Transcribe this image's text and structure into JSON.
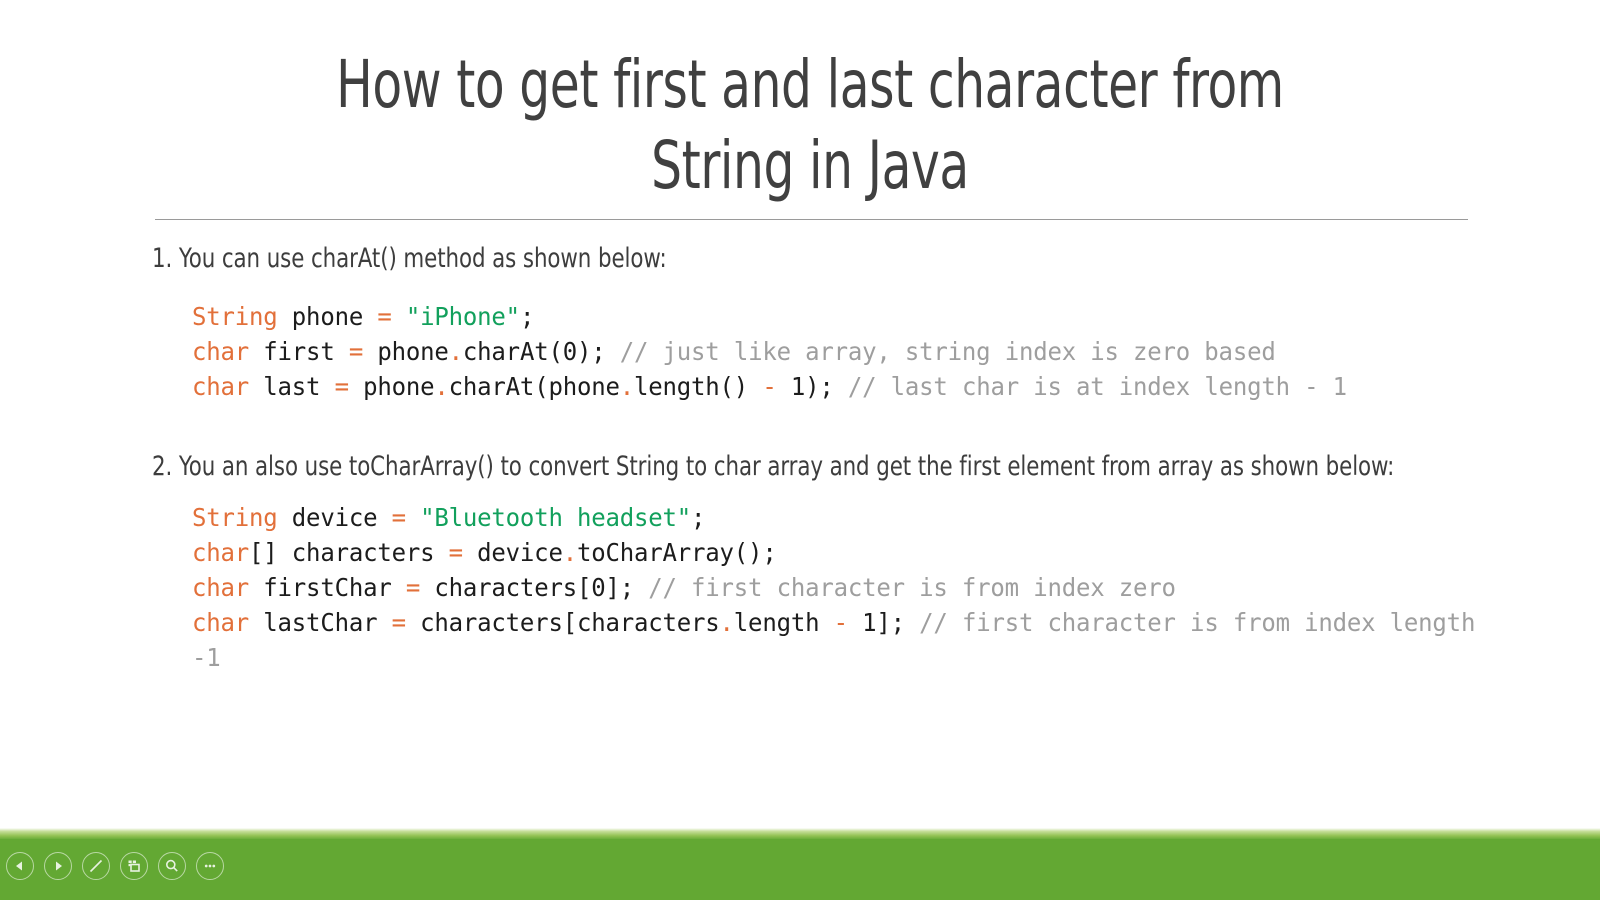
{
  "slide": {
    "title": "How to get first and last character from String in Java",
    "sections": [
      {
        "paragraph": "1. You can use charAt() method as shown below:",
        "code_lines": [
          [
            {
              "t": "String",
              "c": "kw"
            },
            {
              "t": " phone ",
              "c": "plain"
            },
            {
              "t": "=",
              "c": "op"
            },
            {
              "t": " ",
              "c": "plain"
            },
            {
              "t": "\"iPhone\"",
              "c": "str"
            },
            {
              "t": ";",
              "c": "plain"
            }
          ],
          [
            {
              "t": "char",
              "c": "kw"
            },
            {
              "t": " first ",
              "c": "plain"
            },
            {
              "t": "=",
              "c": "op"
            },
            {
              "t": " phone",
              "c": "plain"
            },
            {
              "t": ".",
              "c": "dot"
            },
            {
              "t": "charAt(0); ",
              "c": "plain"
            },
            {
              "t": "// just like array, string index is zero based",
              "c": "cmt"
            }
          ],
          [
            {
              "t": "char",
              "c": "kw"
            },
            {
              "t": " last ",
              "c": "plain"
            },
            {
              "t": "=",
              "c": "op"
            },
            {
              "t": " phone",
              "c": "plain"
            },
            {
              "t": ".",
              "c": "dot"
            },
            {
              "t": "charAt(phone",
              "c": "plain"
            },
            {
              "t": ".",
              "c": "dot"
            },
            {
              "t": "length() ",
              "c": "plain"
            },
            {
              "t": "-",
              "c": "op"
            },
            {
              "t": " 1); ",
              "c": "plain"
            },
            {
              "t": "// last char is at index length - 1",
              "c": "cmt"
            }
          ]
        ]
      },
      {
        "paragraph": "2. You an also use toCharArray() to convert String to char array and get the first element from array as shown below:",
        "code_lines": [
          [
            {
              "t": "String",
              "c": "kw"
            },
            {
              "t": " device ",
              "c": "plain"
            },
            {
              "t": "=",
              "c": "op"
            },
            {
              "t": " ",
              "c": "plain"
            },
            {
              "t": "\"Bluetooth headset\"",
              "c": "str"
            },
            {
              "t": ";",
              "c": "plain"
            }
          ],
          [
            {
              "t": "char",
              "c": "kw"
            },
            {
              "t": "[] characters ",
              "c": "plain"
            },
            {
              "t": "=",
              "c": "op"
            },
            {
              "t": " device",
              "c": "plain"
            },
            {
              "t": ".",
              "c": "dot"
            },
            {
              "t": "toCharArray();",
              "c": "plain"
            }
          ],
          [
            {
              "t": "char",
              "c": "kw"
            },
            {
              "t": " firstChar ",
              "c": "plain"
            },
            {
              "t": "=",
              "c": "op"
            },
            {
              "t": " characters[0]; ",
              "c": "plain"
            },
            {
              "t": "// first character is from index zero",
              "c": "cmt"
            }
          ],
          [
            {
              "t": "char",
              "c": "kw"
            },
            {
              "t": " lastChar ",
              "c": "plain"
            },
            {
              "t": "=",
              "c": "op"
            },
            {
              "t": " characters[characters",
              "c": "plain"
            },
            {
              "t": ".",
              "c": "dot"
            },
            {
              "t": "length ",
              "c": "plain"
            },
            {
              "t": "-",
              "c": "op"
            },
            {
              "t": " 1]; ",
              "c": "plain"
            },
            {
              "t": "// first character is from index length -1",
              "c": "cmt"
            }
          ]
        ]
      }
    ]
  },
  "toolbar": {
    "background_color": "#63a833",
    "buttons": [
      {
        "name": "previous-slide-button",
        "icon": "triangle-left-icon",
        "label": "Previous"
      },
      {
        "name": "next-slide-button",
        "icon": "triangle-right-icon",
        "label": "Next"
      },
      {
        "name": "pen-tool-button",
        "icon": "pen-icon",
        "label": "Pen"
      },
      {
        "name": "slide-grid-button",
        "icon": "grid-slides-icon",
        "label": "All Slides"
      },
      {
        "name": "zoom-button",
        "icon": "magnifier-icon",
        "label": "Zoom"
      },
      {
        "name": "more-options-button",
        "icon": "ellipsis-icon",
        "label": "More options"
      }
    ]
  },
  "theme": {
    "title_color": "#404040",
    "body_color": "#3d3d3d",
    "keyword_color": "#e2703a",
    "string_color": "#12a05c",
    "comment_color": "#9e9e9e",
    "rule_color": "#9a9a9a",
    "toolbar_green": "#63a833"
  }
}
